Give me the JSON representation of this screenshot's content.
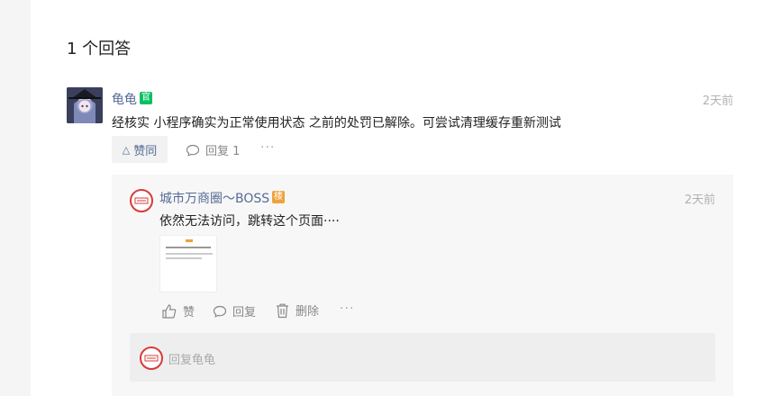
{
  "answers": {
    "title": "1 个回答"
  },
  "answer": {
    "user_name": "龟龟",
    "badge": "官",
    "time": "2天前",
    "content": "经核实 小程序确实为正常使用状态 之前的处罚已解除。可尝试清理缓存重新测试",
    "like_label": "赞同",
    "reply_label": "回复 1",
    "more_label": "···"
  },
  "reply": {
    "user_name": "城市万商圈～BOSS",
    "badge": "楼",
    "time": "2天前",
    "content": "依然无法访问，跳转这个页面····",
    "like_label": "赞",
    "reply_label": "回复",
    "delete_label": "删除",
    "more_label": "···"
  },
  "reply_input": {
    "placeholder": "回复龟龟"
  },
  "colors": {
    "link": "#576b95",
    "official_badge": "#07c160",
    "host_badge": "#f0a13b",
    "seal": "#d83b3b"
  }
}
